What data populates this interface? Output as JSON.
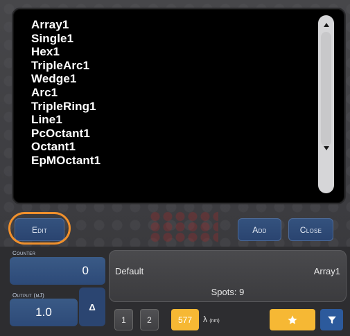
{
  "list": {
    "items": [
      "Array1",
      "Single1",
      "Hex1",
      "TripleArc1",
      "Wedge1",
      "Arc1",
      "TripleRing1",
      "Line1",
      "PcOctant1",
      "Octant1",
      "EpMOctant1"
    ]
  },
  "buttons": {
    "edit": "Edit",
    "add": "Add",
    "close": "Close"
  },
  "counter": {
    "label": "Counter",
    "value": "0"
  },
  "output": {
    "label": "Output (mJ)",
    "value": "1.0",
    "delta": "Δ"
  },
  "info": {
    "preset": "Default",
    "pattern": "Array1",
    "spots": "Spots: 9"
  },
  "toolbar": {
    "btn1": "1",
    "btn2": "2",
    "wavelength": "577",
    "lambda_symbol": "λ",
    "lambda_unit": "(nm)"
  },
  "colors": {
    "accent_orange": "#f6b834",
    "highlight_ring": "#f0902c",
    "button_blue": "#2d4a78"
  },
  "icons": {
    "scroll_up": "triangle-up-icon",
    "scroll_down": "triangle-down-icon",
    "star": "star-icon",
    "filter": "filter-icon"
  }
}
